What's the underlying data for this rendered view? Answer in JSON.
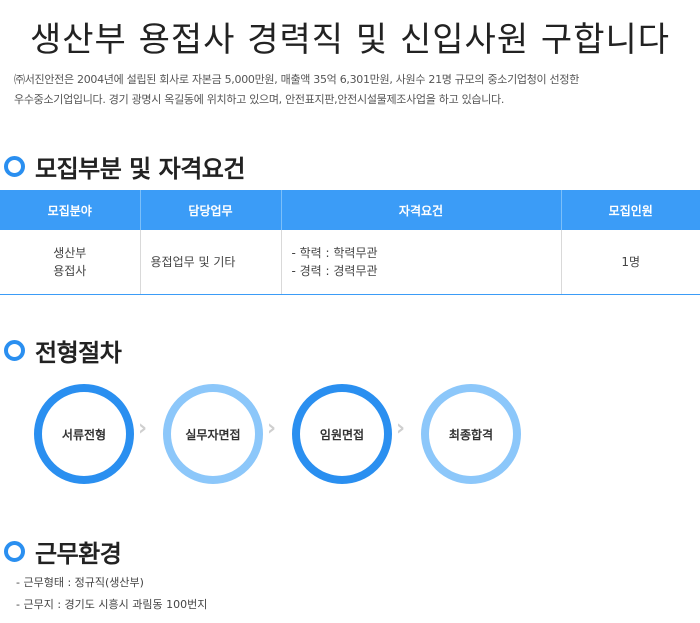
{
  "title": "생산부 용접사 경력직 및 신입사원 구합니다",
  "intro": {
    "line1": "㈜서진안전은 2004년에 설립된 회사로 자본금 5,000만원, 매출액 35억 6,301만원, 사원수 21명 규모의 중소기업청이 선정한",
    "line2": "우수중소기업입니다. 경기 광명시 옥길동에 위치하고 있으며, 안전표지판,안전시설물제조사업을 하고 있습니다."
  },
  "recruit": {
    "heading": "모집부분 및 자격요건",
    "columns": [
      "모집분야",
      "담당업무",
      "자격요건",
      "모집인원"
    ],
    "row": {
      "field_line1": "생산부",
      "field_line2": "용접사",
      "duty": "용접업무 및 기타",
      "qual_line1": "- 학력 : 학력무관",
      "qual_line2": "- 경력 : 경력무관",
      "count": "1명"
    }
  },
  "process": {
    "heading": "전형절차",
    "steps": [
      "서류전형",
      "실무자면접",
      "임원면접",
      "최종합격"
    ],
    "arrow_icon": "chevron-right-icon",
    "colors": {
      "dark": "#2a8ff0",
      "light": "#8cc7fa"
    }
  },
  "work": {
    "heading": "근무환경",
    "type": "- 근무형태 : 정규직(생산부)",
    "location": "- 근무지 : 경기도 시흥시 과림동 100번지"
  },
  "colors": {
    "accent": "#2a8ff0",
    "table_header": "#3b9cf7"
  }
}
